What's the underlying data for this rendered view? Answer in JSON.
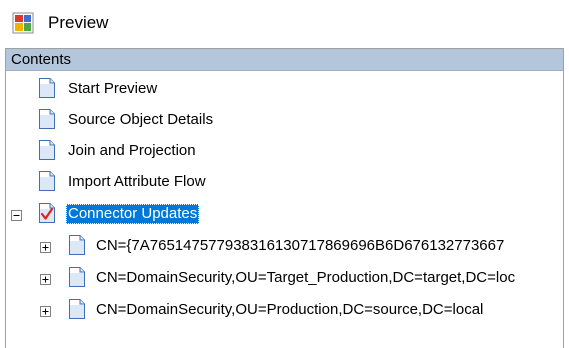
{
  "window": {
    "title": "Preview",
    "icon": "preview-app-icon"
  },
  "contents": {
    "header": "Contents",
    "items": [
      {
        "label": "Start Preview",
        "icon": "document-icon"
      },
      {
        "label": "Source Object Details",
        "icon": "document-icon"
      },
      {
        "label": "Join and Projection",
        "icon": "document-icon"
      },
      {
        "label": "Import Attribute Flow",
        "icon": "document-icon"
      },
      {
        "label": "Connector Updates",
        "icon": "document-check-icon",
        "expander": "minus",
        "selected": true,
        "children": [
          {
            "label": "CN={7A76514757793831613071786969​6B6D676132773667",
            "icon": "document-icon",
            "expander": "plus"
          },
          {
            "label": "CN=DomainSecurity,OU=Target_Production,DC=target,DC=loc",
            "icon": "document-icon",
            "expander": "plus"
          },
          {
            "label": "CN=DomainSecurity,OU=Production,DC=source,DC=local",
            "icon": "document-icon",
            "expander": "plus"
          }
        ]
      }
    ]
  },
  "colors": {
    "header_bg": "#b4c6dc",
    "selection_bg": "#0078d7",
    "selection_text": "#ffffff",
    "check_red": "#e02020"
  }
}
